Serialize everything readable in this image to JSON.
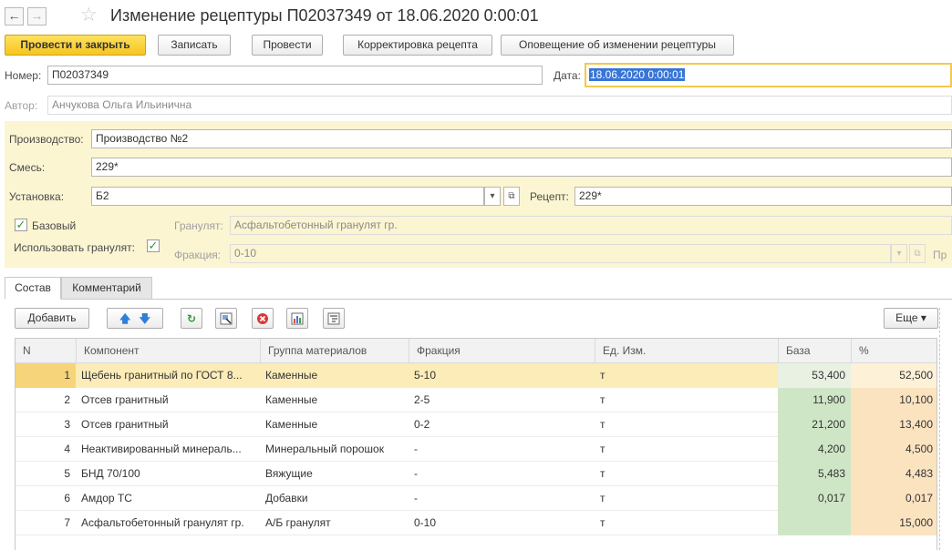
{
  "window": {
    "title": "Изменение рецептуры П02037349 от 18.06.2020 0:00:01",
    "back_icon": "←",
    "forward_icon": "→",
    "star_icon": "☆"
  },
  "commands": {
    "post_and_close": "Провести и закрыть",
    "save": "Записать",
    "post": "Провести",
    "adjust_recipe": "Корректировка рецепта",
    "notify": "Оповещение об изменении рецептуры"
  },
  "header": {
    "number_label": "Номер:",
    "number_value": "П02037349",
    "date_label": "Дата:",
    "date_value": "18.06.2020  0:00:01",
    "author_label": "Автор:",
    "author_value": "Анчукова Ольга Ильинична"
  },
  "production": {
    "production_label": "Производство:",
    "production_value": "Производство №2",
    "mix_label": "Смесь:",
    "mix_value": "229*",
    "plant_label": "Установка:",
    "plant_value": "Б2",
    "recipe_label": "Рецепт:",
    "recipe_value": "229*",
    "base_label": "Базовый",
    "base_checked": true,
    "granulate_label": "Гранулят:",
    "granulate_value": "Асфальтобетонный гранулят гр.",
    "use_granulate_label": "Использовать гранулят:",
    "use_granulate_checked": true,
    "fraction_label": "Фракция:",
    "fraction_value": "0-10",
    "cut_label": "Пр"
  },
  "tabs": [
    {
      "label": "Состав",
      "active": true
    },
    {
      "label": "Комментарий",
      "active": false
    }
  ],
  "toolbar": {
    "add_label": "Добавить",
    "more_label": "Еще ▾"
  },
  "table": {
    "columns": [
      "N",
      "Компонент",
      "Группа материалов",
      "Фракция",
      "Ед. Изм.",
      "База",
      "%"
    ],
    "rows": [
      {
        "n": "1",
        "component": "Щебень гранитный по ГОСТ 8...",
        "group": "Каменные",
        "fraction": "5-10",
        "unit": "т",
        "base": "53,400",
        "pct": "52,500"
      },
      {
        "n": "2",
        "component": "Отсев гранитный",
        "group": "Каменные",
        "fraction": "2-5",
        "unit": "т",
        "base": "11,900",
        "pct": "10,100"
      },
      {
        "n": "3",
        "component": "Отсев гранитный",
        "group": "Каменные",
        "fraction": "0-2",
        "unit": "т",
        "base": "21,200",
        "pct": "13,400"
      },
      {
        "n": "4",
        "component": "Неактивированный минераль...",
        "group": "Минеральный порошок",
        "fraction": "-",
        "unit": "т",
        "base": "4,200",
        "pct": "4,500"
      },
      {
        "n": "5",
        "component": "БНД 70/100",
        "group": "Вяжущие",
        "fraction": "-",
        "unit": "т",
        "base": "5,483",
        "pct": "4,483"
      },
      {
        "n": "6",
        "component": "Амдор ТС",
        "group": "Добавки",
        "fraction": "-",
        "unit": "т",
        "base": "0,017",
        "pct": "0,017"
      },
      {
        "n": "7",
        "component": "Асфальтобетонный гранулят гр.",
        "group": "А/Б гранулят",
        "fraction": "0-10",
        "unit": "т",
        "base": "",
        "pct": "15,000"
      }
    ]
  },
  "colors": {
    "primary_button": "#f6c520",
    "selected_row": "#fbecb8",
    "base_column": "#cfe6c6",
    "percent_column": "#fbe3c0",
    "form_panel": "#fbf5d2"
  }
}
